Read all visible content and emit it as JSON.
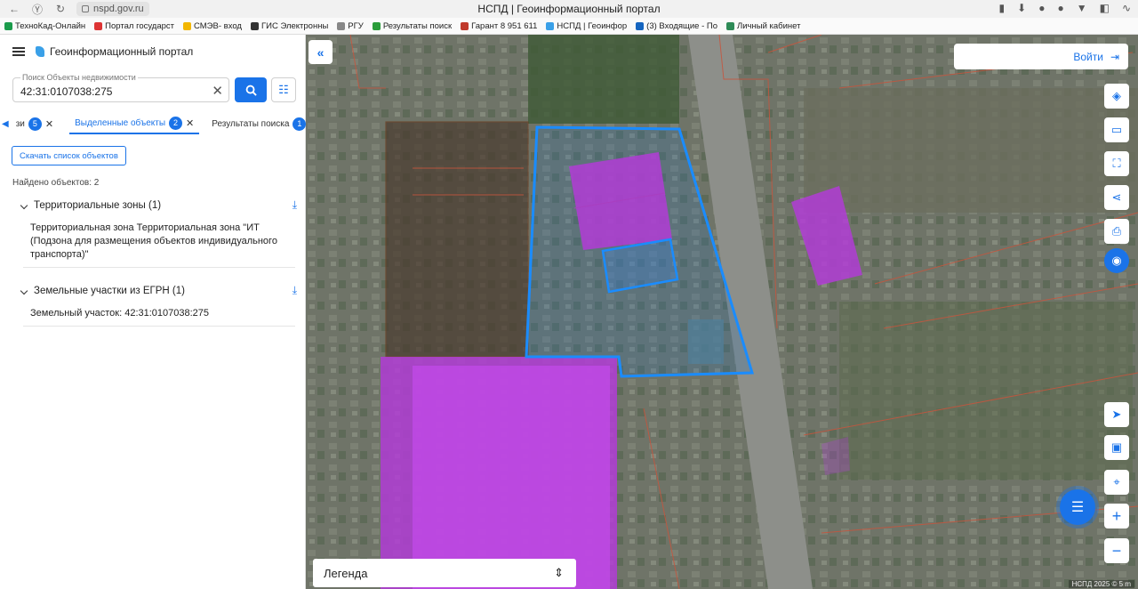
{
  "browser": {
    "url": "nspd.gov.ru",
    "window_title": "НСПД | Геоинформационный портал",
    "bookmarks": [
      {
        "label": "ТехноКад-Онлайн",
        "color": "#1a9b4b"
      },
      {
        "label": "Портал государст",
        "color": "#d33"
      },
      {
        "label": "СМЭВ- вход",
        "color": "#f2b600"
      },
      {
        "label": "ГИС Электронны",
        "color": "#333"
      },
      {
        "label": "РГУ",
        "color": "#888"
      },
      {
        "label": "Результаты поиск",
        "color": "#2a9d3a"
      },
      {
        "label": "Гарант 8 951 611",
        "color": "#c0392b"
      },
      {
        "label": "НСПД | Геоинфор",
        "color": "#3aa0e8"
      },
      {
        "label": "(3) Входящие - По",
        "color": "#1565c0"
      },
      {
        "label": "Личный кабинет",
        "color": "#2e8b57"
      }
    ]
  },
  "portal": {
    "title": "Геоинформационный портал",
    "search": {
      "label": "Поиск Объекты недвижимости",
      "value": "42:31:0107038:275"
    },
    "tabs": [
      {
        "label": "зи",
        "count": "5"
      },
      {
        "label": "Выделенные объекты",
        "count": "2"
      },
      {
        "label": "Результаты поиска",
        "count": "1"
      }
    ],
    "download_list_label": "Скачать список объектов",
    "found_text": "Найдено объектов: 2",
    "groups": [
      {
        "title": "Территориальные зоны (1)",
        "item": "Территориальная зона Территориальная зона \"ИТ (Подзона для размещения объектов индивидуального транспорта)\""
      },
      {
        "title": "Земельные участки из ЕГРН (1)",
        "item": "Земельный участок: 42:31:0107038:275"
      }
    ]
  },
  "map": {
    "login_label": "Войти",
    "legend_label": "Легенда",
    "attribution": "НСПД 2025 ©",
    "scale_label": "5 m"
  },
  "colors": {
    "accent": "#1a73e8",
    "zone_fill": "#b23cd6",
    "selection_outline": "#1a8cff"
  }
}
